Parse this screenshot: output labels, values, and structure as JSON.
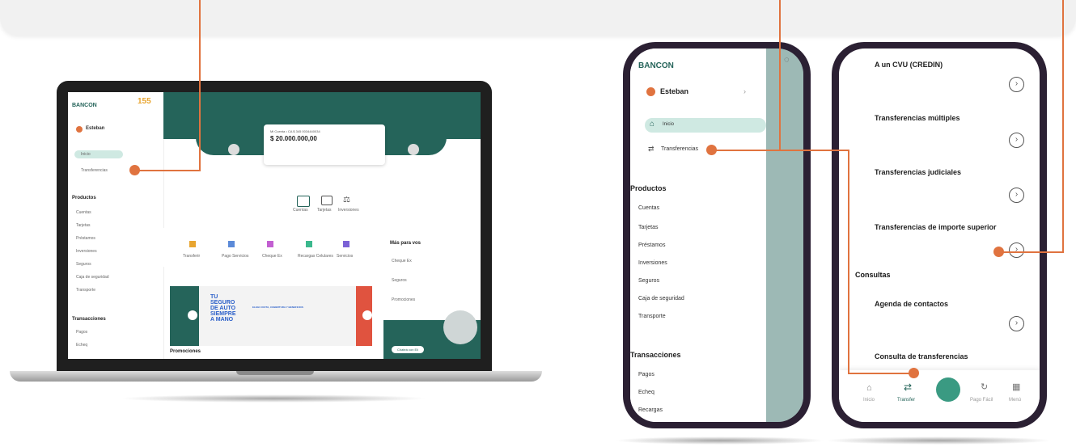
{
  "laptop": {
    "brand": "BANCON",
    "user": "Esteban",
    "menu": {
      "inicio": "Inicio",
      "transferencias": "Transferencias"
    },
    "products_title": "Productos",
    "products": [
      "Cuentas",
      "Tarjetas",
      "Préstamos",
      "Inversiones",
      "Seguros",
      "Caja de seguridad",
      "Transporte"
    ],
    "transactions_title": "Transacciones",
    "transactions": [
      "Pagos",
      "Echeq"
    ],
    "account_label": "Mi Cuenta • CA $ 345 0034440034",
    "balance": "$ 20.000.000,00",
    "quick_actions": [
      "Cuentas",
      "Tarjetas",
      "Inversiones"
    ],
    "shortcuts": [
      "Transferir",
      "Pago Servicios",
      "Cheque Ex",
      "Recargas Celulares",
      "Servicios"
    ],
    "more_title": "Más para vos",
    "more_items": [
      "Cheque Ex",
      "Seguros",
      "Promociones"
    ],
    "promo_text": [
      "TU",
      "SEGURO",
      "DE AUTO",
      "SIEMPRE",
      "A MANO"
    ],
    "promo_tagline": "ELEGI CUOTA, COBERTURA Y BENEFICIOS",
    "promos_title": "Promociones",
    "help_button": "Chateá con Eli"
  },
  "phone1": {
    "brand": "BANCON",
    "user": "Esteban",
    "menu": {
      "inicio": "Inicio",
      "transferencias": "Transferencias"
    },
    "products_title": "Productos",
    "products": [
      "Cuentas",
      "Tarjetas",
      "Préstamos",
      "Inversiones",
      "Seguros",
      "Caja de seguridad",
      "Transporte"
    ],
    "transactions_title": "Transacciones",
    "transactions": [
      "Pagos",
      "Echeq",
      "Recargas"
    ]
  },
  "phone2": {
    "items": [
      "A un CVU (CREDIN)",
      "Transferencias múltiples",
      "Transferencias judiciales",
      "Transferencias de importe superior"
    ],
    "section_title": "Consultas",
    "consultas": [
      "Agenda de contactos",
      "Consulta de transferencias"
    ],
    "nav": [
      "Inicio",
      "Transfer",
      "Pago Fácil",
      "Menú"
    ]
  },
  "colors": {
    "accent": "#e0733f",
    "teal": "#25645a",
    "phone_frame": "#2b2033"
  }
}
